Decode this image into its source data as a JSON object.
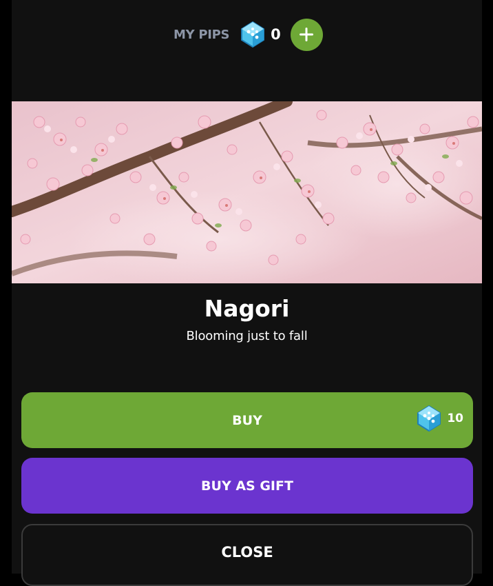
{
  "header": {
    "pips_label": "MY PIPS",
    "pips_count": "0",
    "gem_icon": "blue-dice-gem-icon",
    "add_icon": "plus-icon"
  },
  "item": {
    "title": "Nagori",
    "subtitle": "Blooming just to fall",
    "image": "cherry-blossom-branches-photo"
  },
  "actions": {
    "buy_label": "BUY",
    "buy_price": "10",
    "gift_label": "BUY AS GIFT",
    "close_label": "CLOSE"
  },
  "colors": {
    "background": "#111111",
    "green": "#6ea836",
    "purple": "#6b34cf",
    "muted_label": "#8c95a6"
  }
}
